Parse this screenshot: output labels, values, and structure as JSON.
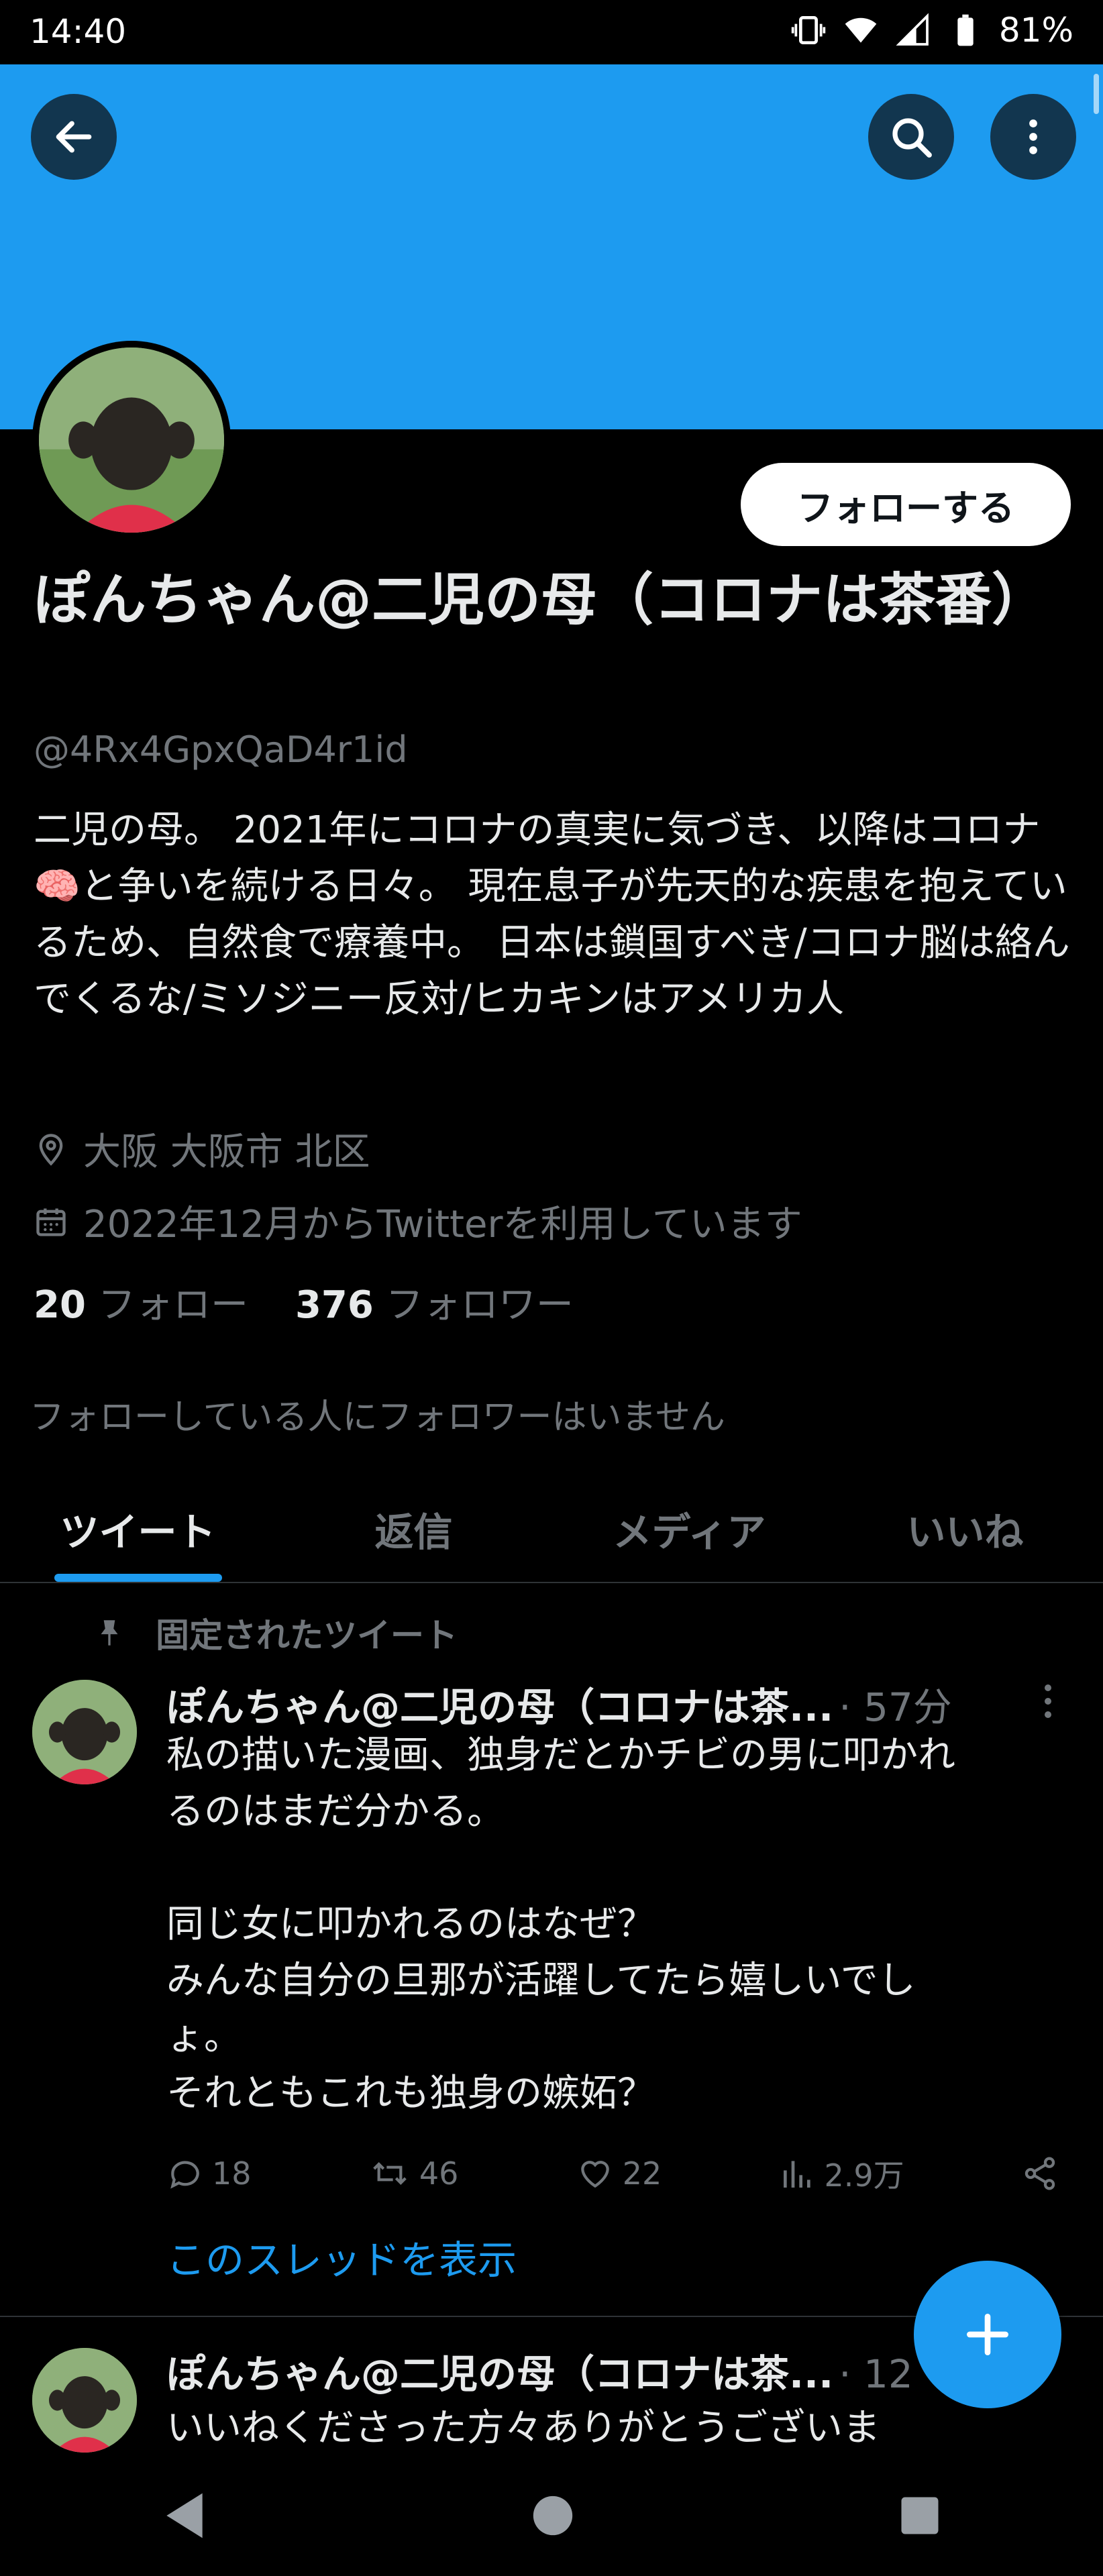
{
  "status_bar": {
    "time": "14:40",
    "battery": "81%"
  },
  "header": {
    "back_label": "back",
    "search_label": "search",
    "more_label": "more"
  },
  "profile": {
    "follow_button": "フォローする",
    "name": "ぽんちゃん@二児の母（コロナは茶番）",
    "handle": "@4Rx4GpxQaD4r1id",
    "bio": "二児の母。 2021年にコロナの真実に気づき、以降はコロナ🧠と争いを続ける日々。 現在息子が先天的な疾患を抱えているため、自然食で療養中。 日本は鎖国すべき/コロナ脳は絡んでくるな/ミソジニー反対/ヒカキンはアメリカ人",
    "location": "大阪 大阪市 北区",
    "joined": "2022年12月からTwitterを利用しています",
    "following_count": "20",
    "following_label": "フォロー",
    "followers_count": "376",
    "followers_label": "フォロワー",
    "mutual_note": "フォローしている人にフォロワーはいません"
  },
  "tabs": [
    {
      "label": "ツイート",
      "active": true
    },
    {
      "label": "返信",
      "active": false
    },
    {
      "label": "メディア",
      "active": false
    },
    {
      "label": "いいね",
      "active": false
    }
  ],
  "pinned_label": "固定されたツイート",
  "tweets": [
    {
      "name": "ぽんちゃん@二児の母（コロナは茶...",
      "meta": "· 57分",
      "lines": [
        "私の描いた漫画、独身だとかチビの男に叩かれ",
        "るのはまだ分かる。",
        "",
        "同じ女に叩かれるのはなぜ？",
        "みんな自分の旦那が活躍してたら嬉しいでし",
        "ょ。",
        "それともこれも独身の嫉妬？"
      ],
      "replies": "18",
      "retweets": "46",
      "likes": "22",
      "views": "2.9万",
      "thread_link": "このスレッドを表示"
    },
    {
      "name": "ぽんちゃん@二児の母（コロナは茶...",
      "meta": "· 12",
      "text": "いいねくださった方々ありがとうございま"
    }
  ],
  "colors": {
    "accent": "#1d9bf0",
    "background": "#000000",
    "muted": "#71767b",
    "text": "#e7e9ea"
  }
}
